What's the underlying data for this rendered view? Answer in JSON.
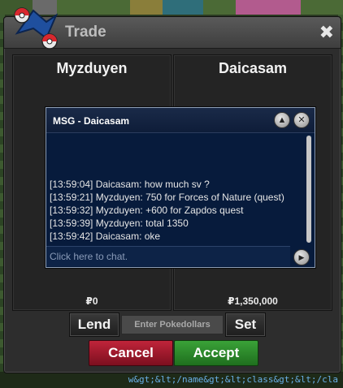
{
  "window": {
    "title": "Trade",
    "close_label": "✖"
  },
  "panels": {
    "left": {
      "name": "Myzduyen",
      "money": "₽0"
    },
    "right": {
      "name": "Daicasam",
      "money": "₽1,350,000"
    }
  },
  "chat": {
    "title": "MSG - Daicasam",
    "messages": [
      "[13:59:04] Daicasam: how much sv ?",
      "[13:59:21] Myzduyen: 750 for Forces of Nature (quest)",
      "[13:59:32] Myzduyen: +600 for Zapdos quest",
      "[13:59:39] Myzduyen: total 1350",
      "[13:59:42] Daicasam: oke"
    ],
    "placeholder": "Click here to chat.",
    "up_icon": "▲",
    "close_icon": "✕",
    "send_icon": "▶"
  },
  "controls": {
    "lend_label": "Lend",
    "pokedollars_placeholder": "Enter Pokedollars",
    "set_label": "Set",
    "cancel_label": "Cancel",
    "accept_label": "Accept"
  },
  "background_text": "w&gt;&lt;/name&gt;&lt;class&gt;&lt;/cla"
}
